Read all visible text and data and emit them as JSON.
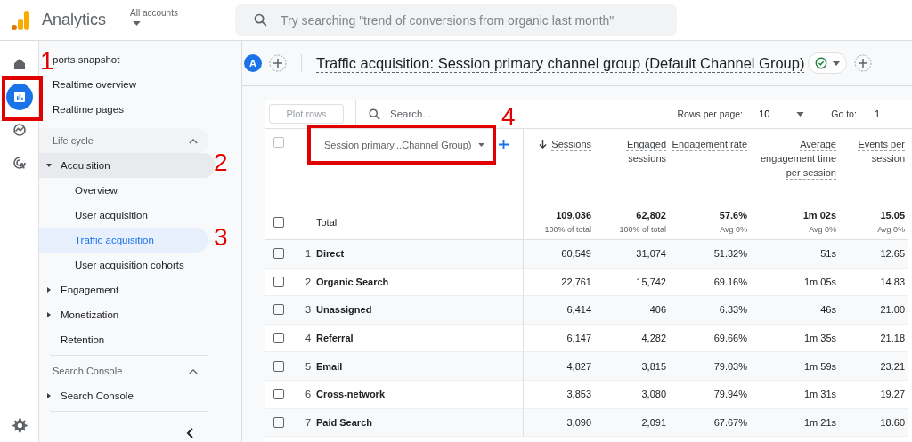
{
  "header": {
    "product": "Analytics",
    "account": "All accounts",
    "search": {
      "placeholder": "Try searching \"trend of conversions from organic last month\""
    }
  },
  "rail": [
    {
      "selected": false
    },
    {
      "selected": true
    },
    {
      "selected": false
    },
    {
      "selected": false
    }
  ],
  "nav": [
    {
      "kind": "link",
      "label": "ports snapshot",
      "selected": false
    },
    {
      "kind": "link",
      "label": "Realtime overview",
      "selected": false
    },
    {
      "kind": "link",
      "label": "Realtime pages",
      "selected": false
    },
    {
      "kind": "section",
      "label": "Life cycle",
      "expanded": true,
      "children": [
        {
          "label": "Acquisition",
          "expanded": true,
          "selected": false,
          "children": [
            {
              "label": "Overview",
              "selected": false
            },
            {
              "label": "User acquisition",
              "selected": false
            },
            {
              "label": "Traffic acquisition",
              "selected": true
            },
            {
              "label": "User acquisition cohorts",
              "selected": false
            }
          ]
        },
        {
          "label": "Engagement",
          "expanded": false,
          "selected": false
        },
        {
          "label": "Monetization",
          "expanded": false,
          "selected": false
        },
        {
          "label": "Retention",
          "selected": false
        }
      ]
    },
    {
      "kind": "section",
      "label": "Search Console",
      "expanded": true,
      "children": [
        {
          "label": "Search Console",
          "expanded": false,
          "selected": false
        }
      ]
    }
  ],
  "report": {
    "avatar": "A",
    "title": "Traffic acquisition: Session primary channel group (Default Channel Group)"
  },
  "toolbar": {
    "plot_rows": "Plot rows",
    "search": {
      "placeholder": "Search..."
    },
    "rows_per_page_label": "Rows per page:",
    "rows_per_page": "10",
    "go_to_label": "Go to:",
    "go_to": "1"
  },
  "table": {
    "all_checked": false,
    "dimension": "Session primary...Channel Group)",
    "columns": [
      {
        "label": "Sessions",
        "sorted": true
      },
      {
        "label": "Engaged sessions",
        "sorted": false
      },
      {
        "label": "Engagement rate",
        "sorted": false
      },
      {
        "label": "Average engagement time per session",
        "sorted": false
      },
      {
        "label": "Events per session",
        "sorted": false
      }
    ],
    "total": {
      "label": "Total",
      "checked": false,
      "values": [
        {
          "value": "109,036",
          "sub": "100% of total"
        },
        {
          "value": "62,802",
          "sub": "100% of total"
        },
        {
          "value": "57.6%",
          "sub": "Avg 0%"
        },
        {
          "value": "1m 02s",
          "sub": "Avg 0%"
        },
        {
          "value": "15.05",
          "sub": "Avg 0%"
        }
      ]
    },
    "rows": [
      {
        "n": "1",
        "name": "Direct",
        "checked": false,
        "values": [
          "60,549",
          "31,074",
          "51.32%",
          "51s",
          "12.65"
        ]
      },
      {
        "n": "2",
        "name": "Organic Search",
        "checked": false,
        "values": [
          "22,761",
          "15,742",
          "69.16%",
          "1m 05s",
          "14.83"
        ]
      },
      {
        "n": "3",
        "name": "Unassigned",
        "checked": false,
        "values": [
          "6,414",
          "406",
          "6.33%",
          "46s",
          "21.00"
        ]
      },
      {
        "n": "4",
        "name": "Referral",
        "checked": false,
        "values": [
          "6,147",
          "4,282",
          "69.66%",
          "1m 35s",
          "21.18"
        ]
      },
      {
        "n": "5",
        "name": "Email",
        "checked": false,
        "values": [
          "4,827",
          "3,815",
          "79.03%",
          "1m 59s",
          "23.21"
        ]
      },
      {
        "n": "6",
        "name": "Cross-network",
        "checked": false,
        "values": [
          "3,853",
          "3,080",
          "79.94%",
          "1m 31s",
          "19.27"
        ]
      },
      {
        "n": "7",
        "name": "Paid Search",
        "checked": false,
        "values": [
          "3,090",
          "2,091",
          "67.67%",
          "1m 21s",
          "18.60"
        ]
      }
    ]
  },
  "annotations": [
    "1",
    "2",
    "3",
    "4"
  ]
}
